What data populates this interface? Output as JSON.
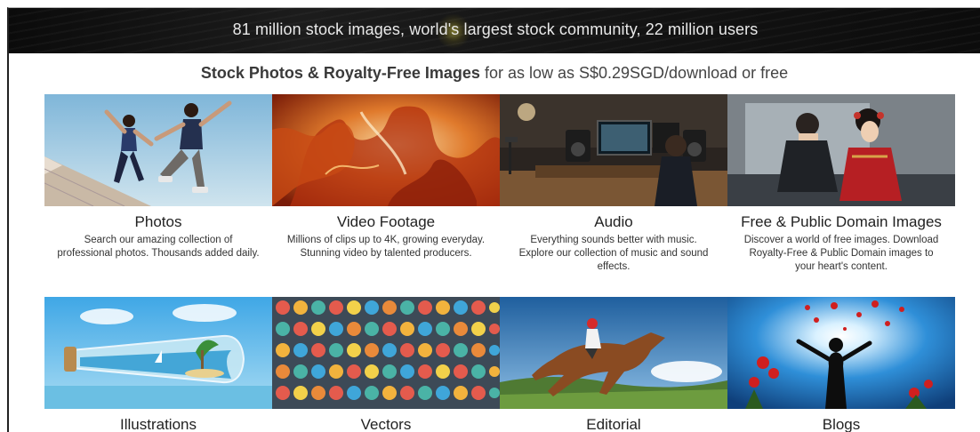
{
  "banner": {
    "text": "81 million stock images, world's largest stock community, 22 million users"
  },
  "subtitle": {
    "bold": "Stock Photos & Royalty-Free Images",
    "rest": " for as low as S$0.29SGD/download or free"
  },
  "categories": [
    {
      "title": "Photos",
      "description": "Search our amazing collection of professional photos. Thousands added daily."
    },
    {
      "title": "Video Footage",
      "description": "Millions of clips up to 4K, growing everyday. Stunning video by talented producers."
    },
    {
      "title": "Audio",
      "description": "Everything sounds better with music. Explore our collection of music and sound effects."
    },
    {
      "title": "Free & Public Domain Images",
      "description": "Discover a world of free images. Download Royalty-Free & Public Domain images to your heart's content."
    },
    {
      "title": "Illustrations",
      "description": ""
    },
    {
      "title": "Vectors",
      "description": ""
    },
    {
      "title": "Editorial",
      "description": ""
    },
    {
      "title": "Blogs",
      "description": ""
    }
  ],
  "colors": {
    "banner_bg": "#111111",
    "banner_text": "#e9e9e9",
    "heading_text": "#3a3a3a"
  }
}
